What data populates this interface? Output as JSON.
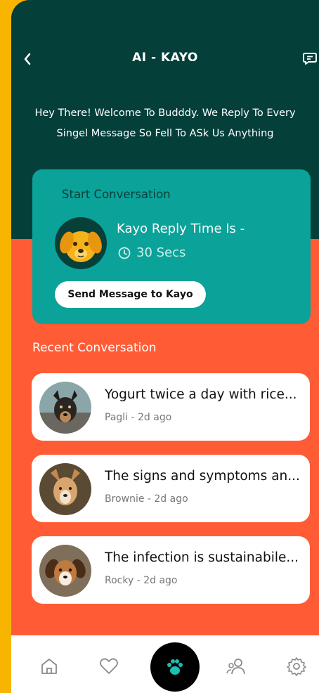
{
  "header": {
    "title": "AI - KAYO"
  },
  "welcome_text": "Hey There! Welcome To Budddy. We Reply To Every Singel Message So Fell To ASk Us Anything",
  "card": {
    "title": "Start Conversation",
    "reply_label": "Kayo Reply Time Is -",
    "reply_time": "30 Secs",
    "send_button": "Send Message to Kayo"
  },
  "recent": {
    "label": "Recent Conversation",
    "items": [
      {
        "message": "Yogurt twice a day with rice...",
        "meta": "Pagli - 2d ago"
      },
      {
        "message": "The signs and symptoms an...",
        "meta": "Brownie - 2d ago"
      },
      {
        "message": "The infection is sustainabile...",
        "meta": "Rocky - 2d ago"
      }
    ]
  },
  "nav": {
    "items": [
      "home-icon",
      "heart-icon",
      "paw-icon",
      "people-icon",
      "settings-icon"
    ]
  },
  "colors": {
    "dark_teal": "#053f3a",
    "teal": "#0aa299",
    "orange": "#ff5c36",
    "yellow": "#f7b500"
  }
}
